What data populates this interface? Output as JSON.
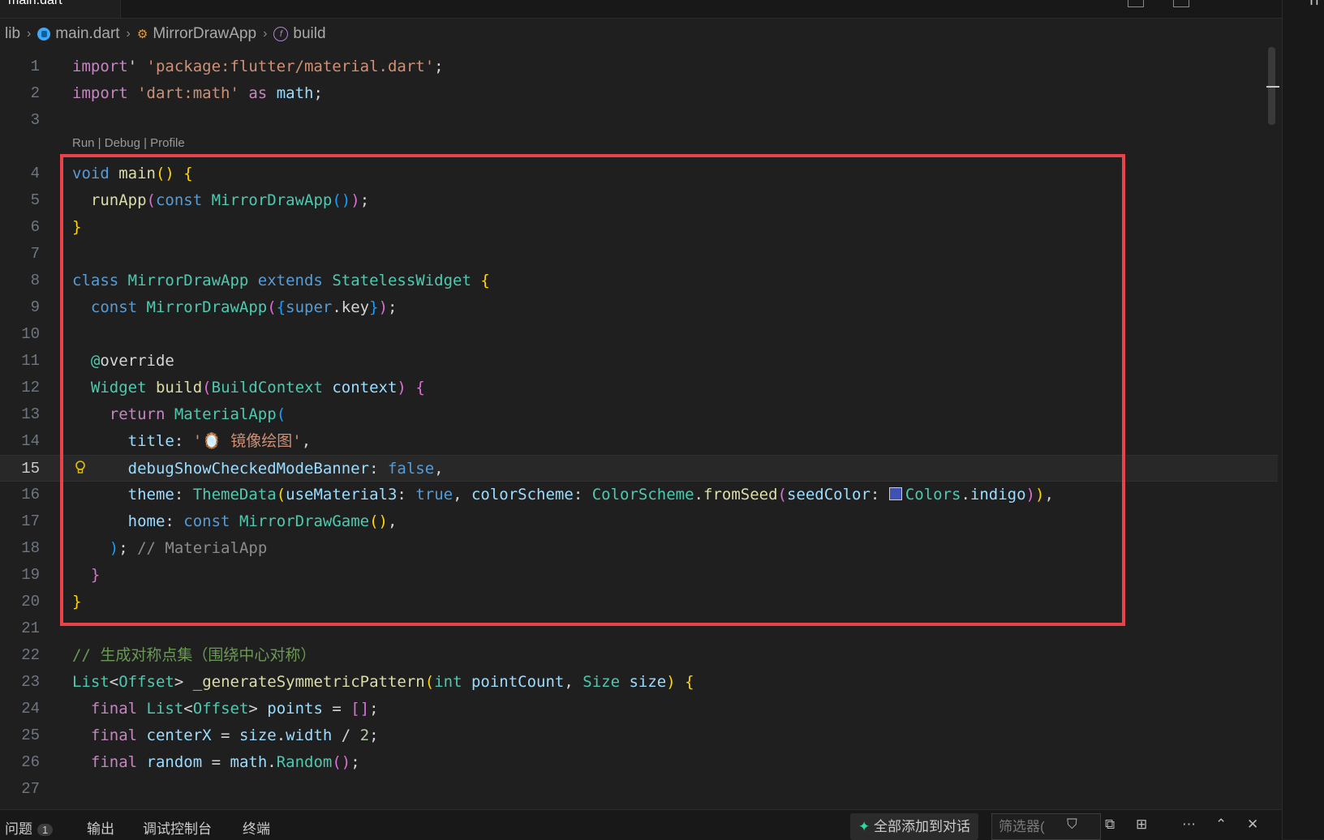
{
  "window": {
    "active_tab_label": "main.dart",
    "right_pane_label": "Ti"
  },
  "breadcrumb": {
    "items": [
      {
        "label": "lib",
        "icon": ""
      },
      {
        "label": "main.dart",
        "icon": "dart-file-icon"
      },
      {
        "label": "MirrorDrawApp",
        "icon": "class-icon"
      },
      {
        "label": "build",
        "icon": "function-icon"
      }
    ]
  },
  "editor": {
    "codelens": "Run | Debug | Profile",
    "current_line": 15,
    "lines": [
      {
        "n": "1"
      },
      {
        "n": "2"
      },
      {
        "n": "3"
      },
      {
        "n": "4"
      },
      {
        "n": "5"
      },
      {
        "n": "6"
      },
      {
        "n": "7"
      },
      {
        "n": "8"
      },
      {
        "n": "9"
      },
      {
        "n": "10"
      },
      {
        "n": "11"
      },
      {
        "n": "12"
      },
      {
        "n": "13"
      },
      {
        "n": "14"
      },
      {
        "n": "15"
      },
      {
        "n": "16"
      },
      {
        "n": "17"
      },
      {
        "n": "18"
      },
      {
        "n": "19"
      },
      {
        "n": "20"
      },
      {
        "n": "21"
      },
      {
        "n": "22"
      },
      {
        "n": "23"
      },
      {
        "n": "24"
      },
      {
        "n": "25"
      },
      {
        "n": "26"
      },
      {
        "n": "27"
      }
    ],
    "code": [
      [
        [
          "kw2",
          "import"
        ],
        [
          "",
          "' "
        ],
        [
          "str",
          "'package:flutter/material.dart'"
        ],
        [
          "",
          ";"
        ]
      ],
      [
        [
          "kw2",
          "import"
        ],
        [
          "",
          ""
        ],
        [
          "str",
          " 'dart:math'"
        ],
        [
          "kw2",
          " as"
        ],
        [
          "var",
          " math"
        ],
        [
          "",
          ";"
        ]
      ],
      [],
      [
        [
          "kw",
          "void"
        ],
        [
          "fn",
          " main"
        ],
        [
          "b1",
          "()"
        ],
        [
          "b1",
          " {"
        ]
      ],
      [
        [
          "",
          "  "
        ],
        [
          "fn",
          "runApp"
        ],
        [
          "b2",
          "("
        ],
        [
          "kw",
          "const"
        ],
        [
          "ty",
          " MirrorDrawApp"
        ],
        [
          "b3",
          "()"
        ],
        [
          "b2",
          ")"
        ],
        [
          "",
          ";"
        ]
      ],
      [
        [
          "b1",
          "}"
        ]
      ],
      [],
      [
        [
          "kw",
          "class"
        ],
        [
          "ty",
          " MirrorDrawApp"
        ],
        [
          "kw",
          " extends"
        ],
        [
          "ty",
          " StatelessWidget"
        ],
        [
          "b1",
          " {"
        ]
      ],
      [
        [
          "",
          "  "
        ],
        [
          "kw",
          "const"
        ],
        [
          "ty",
          " MirrorDrawApp"
        ],
        [
          "b2",
          "("
        ],
        [
          "b3",
          "{"
        ],
        [
          "kw",
          "super"
        ],
        [
          "",
          ".key"
        ],
        [
          "b3",
          "}"
        ],
        [
          "b2",
          ")"
        ],
        [
          "",
          ";"
        ]
      ],
      [],
      [
        [
          "",
          "  "
        ],
        [
          "ty",
          "@"
        ],
        [
          "",
          "override"
        ]
      ],
      [
        [
          "",
          "  "
        ],
        [
          "ty",
          "Widget"
        ],
        [
          "fn",
          " build"
        ],
        [
          "b2",
          "("
        ],
        [
          "ty",
          "BuildContext"
        ],
        [
          "var",
          " context"
        ],
        [
          "b2",
          ")"
        ],
        [
          "b2",
          " {"
        ]
      ],
      [
        [
          "",
          "    "
        ],
        [
          "kw2",
          "return"
        ],
        [
          "ty",
          " MaterialApp"
        ],
        [
          "b3",
          "("
        ]
      ],
      [
        [
          "",
          "      "
        ],
        [
          "var",
          "title"
        ],
        [
          "",
          ": "
        ],
        [
          "str",
          "'🪞 镜像绘图'"
        ],
        [
          "",
          ","
        ]
      ],
      [
        [
          "",
          "      "
        ],
        [
          "var",
          "debugShowCheckedModeBanner"
        ],
        [
          "",
          ": "
        ],
        [
          "kw",
          "false"
        ],
        [
          "",
          ","
        ]
      ],
      [
        [
          "",
          "      "
        ],
        [
          "var",
          "theme"
        ],
        [
          "",
          ": "
        ],
        [
          "ty",
          "ThemeData"
        ],
        [
          "b1",
          "("
        ],
        [
          "var",
          "useMaterial3"
        ],
        [
          "",
          ": "
        ],
        [
          "kw",
          "true"
        ],
        [
          "",
          ", "
        ],
        [
          "var",
          "colorScheme"
        ],
        [
          "",
          ": "
        ],
        [
          "ty",
          "ColorScheme"
        ],
        [
          "",
          "."
        ],
        [
          "fn",
          "fromSeed"
        ],
        [
          "b2",
          "("
        ],
        [
          "var",
          "seedColor"
        ],
        [
          "",
          ": "
        ],
        [
          "box",
          ""
        ],
        [
          "ty",
          "Colors"
        ],
        [
          "",
          "."
        ],
        [
          "var",
          "indigo"
        ],
        [
          "b2",
          ")"
        ],
        [
          "b1",
          ")"
        ],
        [
          "",
          ","
        ]
      ],
      [
        [
          "",
          "      "
        ],
        [
          "var",
          "home"
        ],
        [
          "",
          ": "
        ],
        [
          "kw",
          "const"
        ],
        [
          "ty",
          " MirrorDrawGame"
        ],
        [
          "b1",
          "()"
        ],
        [
          "",
          ","
        ]
      ],
      [
        [
          "",
          "    "
        ],
        [
          "b3",
          ")"
        ],
        [
          "",
          ";"
        ],
        [
          "cmg",
          " // MaterialApp"
        ]
      ],
      [
        [
          "",
          "  "
        ],
        [
          "b2",
          "}"
        ]
      ],
      [
        [
          "b1",
          "}"
        ]
      ],
      [],
      [
        [
          "cm",
          "// 生成对称点集（围绕中心对称）"
        ]
      ],
      [
        [
          "ty",
          "List"
        ],
        [
          "",
          "<"
        ],
        [
          "ty",
          "Offset"
        ],
        [
          "",
          "> "
        ],
        [
          "fn",
          "_generateSymmetricPattern"
        ],
        [
          "b1",
          "("
        ],
        [
          "ty",
          "int"
        ],
        [
          "var",
          " pointCount"
        ],
        [
          "",
          ", "
        ],
        [
          "ty",
          "Size"
        ],
        [
          "var",
          " size"
        ],
        [
          "b1",
          ")"
        ],
        [
          "b1",
          " {"
        ]
      ],
      [
        [
          "",
          "  "
        ],
        [
          "kw2",
          "final"
        ],
        [
          "ty",
          " List"
        ],
        [
          "",
          "<"
        ],
        [
          "ty",
          "Offset"
        ],
        [
          "",
          "> "
        ],
        [
          "var",
          "points"
        ],
        [
          "",
          " = "
        ],
        [
          "b2",
          "[]"
        ],
        [
          "",
          ";"
        ]
      ],
      [
        [
          "",
          "  "
        ],
        [
          "kw2",
          "final"
        ],
        [
          "var",
          " centerX"
        ],
        [
          "",
          " = "
        ],
        [
          "var",
          "size"
        ],
        [
          "",
          "."
        ],
        [
          "var",
          "width"
        ],
        [
          "",
          " / "
        ],
        [
          "num",
          "2"
        ],
        [
          "",
          ";"
        ]
      ],
      [
        [
          "",
          "  "
        ],
        [
          "kw2",
          "final"
        ],
        [
          "var",
          " random"
        ],
        [
          "",
          " = "
        ],
        [
          "var",
          "math"
        ],
        [
          "",
          "."
        ],
        [
          "ty",
          "Random"
        ],
        [
          "b2",
          "()"
        ],
        [
          "",
          ";"
        ]
      ],
      []
    ]
  },
  "panel": {
    "tabs": [
      {
        "label": "问题",
        "badge": "1"
      },
      {
        "label": "输出"
      },
      {
        "label": "调试控制台"
      },
      {
        "label": "终端"
      }
    ],
    "add_all_label": "全部添加到对话",
    "filter_placeholder": "筛选器(",
    "icons": [
      "filter-icon",
      "copy-icon",
      "layout-icon",
      "more-icon",
      "chevron-up-icon",
      "close-icon"
    ]
  }
}
